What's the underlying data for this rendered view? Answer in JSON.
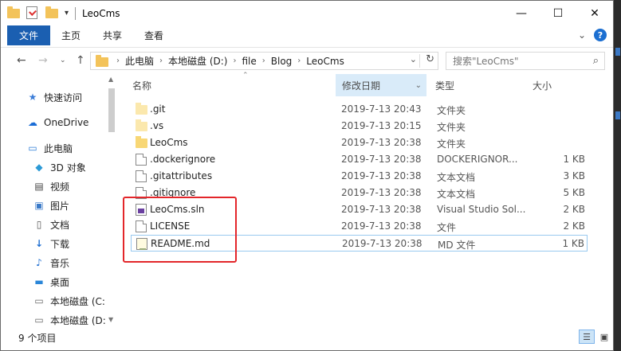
{
  "window": {
    "title": "LeoCms",
    "controls": [
      "—",
      "☐",
      "✕"
    ]
  },
  "ribbon": {
    "tabs": [
      "文件",
      "主页",
      "共享",
      "查看"
    ],
    "help": "?"
  },
  "address": {
    "crumbs": [
      "此电脑",
      "本地磁盘 (D:)",
      "file",
      "Blog",
      "LeoCms"
    ]
  },
  "search": {
    "placeholder": "搜索\"LeoCms\""
  },
  "nav": {
    "items": [
      {
        "label": "快速访问",
        "icon": "star-icon"
      },
      {
        "label": "OneDrive",
        "icon": "cloud-icon"
      },
      {
        "label": "此电脑",
        "icon": "computer-icon"
      },
      {
        "label": "3D 对象",
        "icon": "cube-icon"
      },
      {
        "label": "视频",
        "icon": "video-icon"
      },
      {
        "label": "图片",
        "icon": "picture-icon"
      },
      {
        "label": "文档",
        "icon": "document-icon"
      },
      {
        "label": "下载",
        "icon": "download-icon"
      },
      {
        "label": "音乐",
        "icon": "music-icon"
      },
      {
        "label": "桌面",
        "icon": "desktop-icon"
      },
      {
        "label": "本地磁盘 (C:",
        "icon": "drive-icon"
      },
      {
        "label": "本地磁盘 (D:",
        "icon": "drive-icon"
      }
    ]
  },
  "columns": {
    "name": "名称",
    "date": "修改日期",
    "type": "类型",
    "size": "大小"
  },
  "files": [
    {
      "name": ".git",
      "date": "2019-7-13 20:43",
      "type": "文件夹",
      "size": "",
      "icon": "folder-icon"
    },
    {
      "name": ".vs",
      "date": "2019-7-13 20:15",
      "type": "文件夹",
      "size": "",
      "icon": "folder-icon"
    },
    {
      "name": "LeoCms",
      "date": "2019-7-13 20:38",
      "type": "文件夹",
      "size": "",
      "icon": "folder-icon"
    },
    {
      "name": ".dockerignore",
      "date": "2019-7-13 20:38",
      "type": "DOCKERIGNOR...",
      "size": "1 KB",
      "icon": "file-icon"
    },
    {
      "name": ".gitattributes",
      "date": "2019-7-13 20:38",
      "type": "文本文档",
      "size": "3 KB",
      "icon": "text-file-icon"
    },
    {
      "name": ".gitignore",
      "date": "2019-7-13 20:38",
      "type": "文本文档",
      "size": "5 KB",
      "icon": "text-file-icon"
    },
    {
      "name": "LeoCms.sln",
      "date": "2019-7-13 20:38",
      "type": "Visual Studio Sol...",
      "size": "2 KB",
      "icon": "solution-file-icon"
    },
    {
      "name": "LICENSE",
      "date": "2019-7-13 20:38",
      "type": "文件",
      "size": "2 KB",
      "icon": "file-icon"
    },
    {
      "name": "README.md",
      "date": "2019-7-13 20:38",
      "type": "MD 文件",
      "size": "1 KB",
      "icon": "markdown-file-icon"
    }
  ],
  "status": {
    "count": "9 个项目"
  }
}
